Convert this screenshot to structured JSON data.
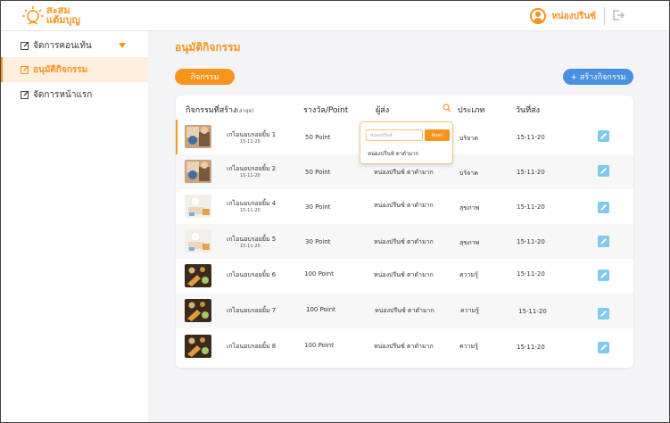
{
  "header": {
    "logo_line1": "สะสม",
    "logo_line2": "แต้มบุญ",
    "user_name": "หน่องปรีนซ์"
  },
  "sidebar": {
    "items": [
      {
        "label": "จัดการคอนเท้น"
      },
      {
        "label": "อนุมัติกิจกรรม"
      },
      {
        "label": "จัดการหน้าแรก"
      }
    ]
  },
  "main": {
    "title": "อนุมัติกิจกรรม",
    "tab_label": "กิจกรรม",
    "create_button": "+ สร้างกิจกรรม"
  },
  "table": {
    "columns": {
      "activity": "กิจกรรมที่สร้าง",
      "activity_note": "(ล่าสุด)",
      "reward": "รางวัล/Point",
      "sender": "ผู้ส่ง",
      "type": "ประเภท",
      "date": "วันที่ส่ง"
    },
    "rows": [
      {
        "name": "เกไอนอบรอยยิ้ม 1",
        "sub": "15-11-20",
        "reward": "50 Point",
        "sender": "",
        "type": "บริจาค",
        "date": "15-11-20"
      },
      {
        "name": "เกไอนอบรอยยิ้ม 2",
        "sub": "15-11-20",
        "reward": "50 Point",
        "sender": "หน่องปรีนซ์ ตาดำมาก",
        "type": "บริจาค",
        "date": "15-11-20"
      },
      {
        "name": "เกไอนอบรอยยิ้ม 4",
        "sub": "15-11-20",
        "reward": "30 Point",
        "sender": "หน่องปรีนซ์ ตาดำมาก",
        "type": "สุขภาพ",
        "date": "15-11-20"
      },
      {
        "name": "เกไอนอบรอยยิ้ม 5",
        "sub": "15-11-20",
        "reward": "30 Point",
        "sender": "หน่องปรีนซ์ ตาดำมาก",
        "type": "สุขภาพ",
        "date": "15-11-20"
      },
      {
        "name": "เกไอนอบรอยยิ้ม 6",
        "sub": "",
        "reward": "100 Point",
        "sender": "หน่องปรีนซ์ ตาดำมาก",
        "type": "ความรู้",
        "date": "15-11-20"
      },
      {
        "name": "เกไอนอบรอยยิ้ม 7",
        "sub": "",
        "reward": "100 Point",
        "sender": "หน่องปรีนซ์ ตาดำมาก",
        "type": "ความรู้",
        "date": "15-11-20"
      },
      {
        "name": "เกไอนอบรอยยิ้ม 8",
        "sub": "",
        "reward": "100 Point",
        "sender": "หน่องปรีนซ์ ตาดำมาก",
        "type": "ความรู้",
        "date": "15-11-20"
      }
    ]
  },
  "filter_popup": {
    "placeholder": "หน่องปรีนซ์",
    "button": "ค้นหา",
    "option": "หน่องปรีนซ์ ตาดำมาก"
  },
  "colors": {
    "accent": "#f7941d",
    "primary_blue": "#4a90e2",
    "edit_icon_bg": "#7fc8ee"
  }
}
